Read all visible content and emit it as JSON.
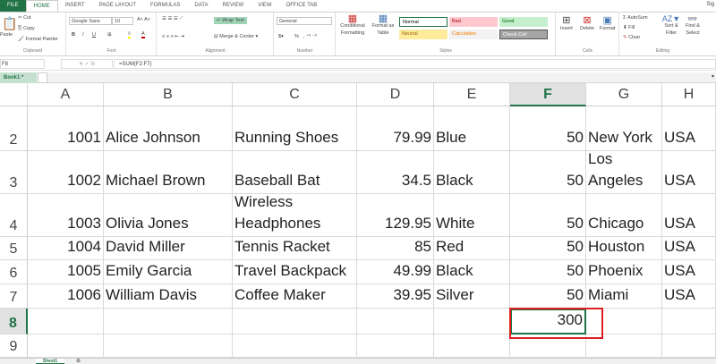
{
  "ribbon_tabs": [
    "FILE",
    "HOME",
    "INSERT",
    "PAGE LAYOUT",
    "FORMULAS",
    "DATA",
    "REVIEW",
    "VIEW",
    "OFFICE TAB"
  ],
  "active_tab": "HOME",
  "sign_in": "Sig",
  "clipboard": {
    "paste": "Paste",
    "cut": "Cut",
    "copy": "Copy",
    "format_painter": "Format Painter",
    "label": "Clipboard"
  },
  "font": {
    "name": "Google Sans",
    "size": "10",
    "label": "Font",
    "bold": "B",
    "italic": "I",
    "underline": "U"
  },
  "alignment": {
    "wrap_text": "Wrap Text",
    "merge_center": "Merge & Center",
    "label": "Alignment"
  },
  "number": {
    "format": "General",
    "label": "Number",
    "percent": "%"
  },
  "styles": {
    "conditional": "Conditional Formatting",
    "format_table": "Format as Table",
    "label": "Styles",
    "items": [
      {
        "name": "Normal",
        "bg": "#ffffff",
        "fg": "#000000"
      },
      {
        "name": "Bad",
        "bg": "#ffc7ce",
        "fg": "#9c0006"
      },
      {
        "name": "Good",
        "bg": "#c6efce",
        "fg": "#006100"
      },
      {
        "name": "Neutral",
        "bg": "#ffeb9c",
        "fg": "#9c6500"
      },
      {
        "name": "Calculation",
        "bg": "#f2f2f2",
        "fg": "#fa7d00"
      },
      {
        "name": "Check Cell",
        "bg": "#a5a5a5",
        "fg": "#ffffff"
      }
    ]
  },
  "cells_group": {
    "insert": "Insert",
    "delete": "Delete",
    "format": "Format",
    "label": "Cells"
  },
  "editing": {
    "autosum": "AutoSum",
    "fill": "Fill",
    "clear": "Clear",
    "sort_filter": "Sort & Filter",
    "find_select": "Find & Select",
    "label": "Editing"
  },
  "formula_bar": {
    "name_box": "F8",
    "formula": "=SUM(F2:F7)",
    "fx": "fx"
  },
  "workbook_tab": "Book1 *",
  "columns": [
    "A",
    "B",
    "C",
    "D",
    "E",
    "F",
    "G",
    "H"
  ],
  "selected_column": "F",
  "rows": [
    {
      "n": "2",
      "cells": [
        "1001",
        "Alice Johnson",
        "Running Shoes",
        "79.99",
        "Blue",
        "50",
        "New York",
        "USA"
      ]
    },
    {
      "n": "3",
      "cells": [
        "1002",
        "Michael Brown",
        "Baseball Bat",
        "34.5",
        "Black",
        "50",
        "Los Angeles",
        "USA"
      ]
    },
    {
      "n": "4",
      "cells": [
        "1003",
        "Olivia Jones",
        "Wireless Headphones",
        "129.95",
        "White",
        "50",
        "Chicago",
        "USA"
      ]
    },
    {
      "n": "5",
      "cells": [
        "1004",
        "David Miller",
        "Tennis Racket",
        "85",
        "Red",
        "50",
        "Houston",
        "USA"
      ]
    },
    {
      "n": "6",
      "cells": [
        "1005",
        "Emily Garcia",
        "Travel Backpack",
        "49.99",
        "Black",
        "50",
        "Phoenix",
        "USA"
      ]
    },
    {
      "n": "7",
      "cells": [
        "1006",
        "William Davis",
        "Coffee Maker",
        "39.95",
        "Silver",
        "50",
        "Miami",
        "USA"
      ]
    },
    {
      "n": "8",
      "cells": [
        "",
        "",
        "",
        "",
        "",
        "300",
        "",
        ""
      ]
    },
    {
      "n": "9",
      "cells": [
        "",
        "",
        "",
        "",
        "",
        "",
        "",
        ""
      ]
    }
  ],
  "selected_row": "8",
  "sheet_tab": "Sheet1",
  "colors": {
    "accent": "#217346",
    "highlight_box": "#e02020"
  }
}
